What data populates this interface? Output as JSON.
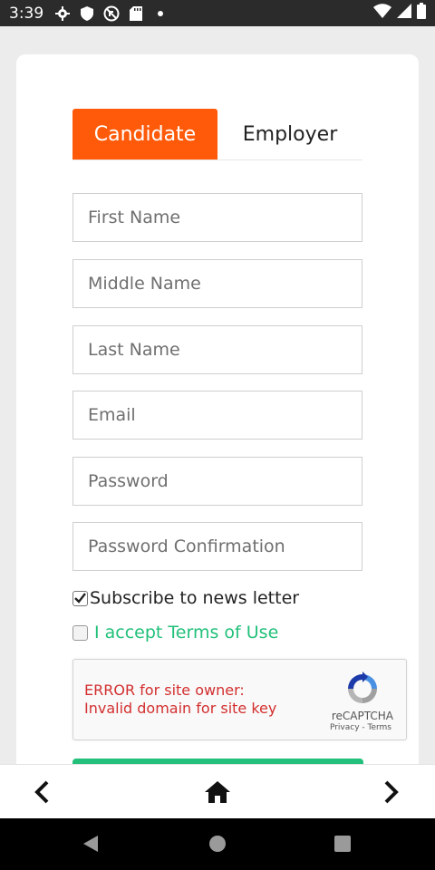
{
  "status_bar": {
    "time": "3:39",
    "left_icons": [
      "gear-icon",
      "shield-icon",
      "no-entry-icon",
      "sd-card-icon",
      "dot-icon"
    ],
    "right_icons": [
      "wifi-icon",
      "signal-icon",
      "battery-icon"
    ]
  },
  "tabs": [
    {
      "label": "Candidate",
      "active": true
    },
    {
      "label": "Employer",
      "active": false
    }
  ],
  "form": {
    "first_name": {
      "placeholder": "First Name",
      "value": ""
    },
    "middle_name": {
      "placeholder": "Middle Name",
      "value": ""
    },
    "last_name": {
      "placeholder": "Last Name",
      "value": ""
    },
    "email": {
      "placeholder": "Email",
      "value": ""
    },
    "password": {
      "placeholder": "Password",
      "value": ""
    },
    "password_confirmation": {
      "placeholder": "Password Confirmation",
      "value": ""
    },
    "subscribe": {
      "label": "Subscribe to news letter",
      "checked": true
    },
    "terms": {
      "label": "I accept Terms of Use",
      "checked": false
    }
  },
  "recaptcha": {
    "error_line1": "ERROR for site owner:",
    "error_line2": "Invalid domain for site key",
    "brand": "reCAPTCHA",
    "links": "Privacy - Terms"
  },
  "colors": {
    "accent": "#ff5a0a",
    "green": "#22c07a",
    "error": "#d32f2f"
  },
  "app_nav": [
    "back-chevron-icon",
    "home-icon",
    "forward-chevron-icon"
  ],
  "system_nav": [
    "back-triangle-icon",
    "home-circle-icon",
    "recents-square-icon"
  ]
}
